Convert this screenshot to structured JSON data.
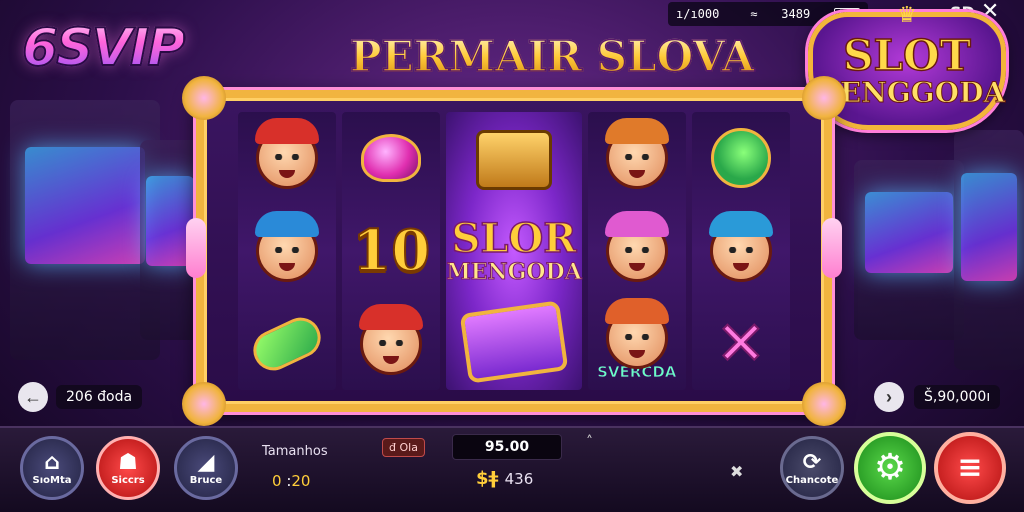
{
  "brand": {
    "logo": "6SVIP",
    "game_title": "PERMAIR SLOVA"
  },
  "status_bar": {
    "left": "ı/ı000 ",
    "wifi": "≈",
    "time": "3489",
    "battery": "[0-"
  },
  "top_right": {
    "label": "SD",
    "close": "✕"
  },
  "badge": {
    "line1": "SLOT",
    "line2": "MENGGODA"
  },
  "reels": {
    "center_title": "SLOR",
    "center_subtitle": "MENGODA",
    "number_symbol": "10",
    "svercda_label": "SVERCDA"
  },
  "nav": {
    "left_arrow": "←",
    "left_label": "206 đoda",
    "right_arrow": "›",
    "right_label": "Š,90,000ı"
  },
  "bottom": {
    "home_label": "SıoMta",
    "store_label": "Siccrs",
    "bruce_label": "Bruce",
    "tamanhos_label": "Tamanhos",
    "bet_value_a": "0",
    "bet_sep": ":",
    "bet_value_b": "20",
    "ola_tag": "đ Ola",
    "win_value": "95.00",
    "credit_symbol": "$ǂ",
    "credit_value": "436",
    "chance_label": "Chancote",
    "up_chevron": "˄",
    "auto_icon": "✖"
  },
  "icons": {
    "home": "⌂",
    "store": "☗",
    "bruce": "◢",
    "chance": "⟳",
    "spin": "⚙",
    "stop": "≡"
  },
  "colors": {
    "gold": "#f1b43f",
    "pink": "#ff8fd6",
    "purple_bg": "#2c0f4a",
    "spin_green": "#5ad84a",
    "stop_red": "#ff4a4a"
  }
}
